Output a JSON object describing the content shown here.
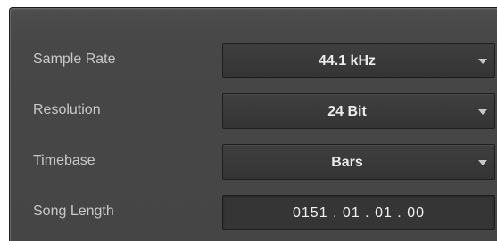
{
  "settings": {
    "sample_rate": {
      "label": "Sample Rate",
      "value": "44.1 kHz",
      "icon": "chevron-down-icon"
    },
    "resolution": {
      "label": "Resolution",
      "value": "24 Bit",
      "icon": "chevron-down-icon"
    },
    "timebase": {
      "label": "Timebase",
      "value": "Bars",
      "icon": "chevron-down-icon"
    },
    "song_length": {
      "label": "Song Length",
      "value": "0151 . 01 . 01 . 00"
    }
  },
  "colors": {
    "panel_background": "#474747",
    "control_background": "#383838",
    "label_text": "#c9c9c9",
    "value_text": "#ececec"
  }
}
